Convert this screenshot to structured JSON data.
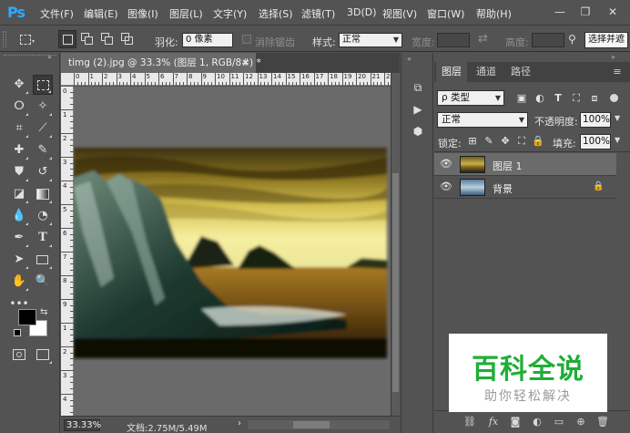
{
  "app": {
    "logo": "Ps"
  },
  "menu": [
    "文件(F)",
    "编辑(E)",
    "图像(I)",
    "图层(L)",
    "文字(Y)",
    "选择(S)",
    "滤镜(T)",
    "3D(D)",
    "视图(V)",
    "窗口(W)",
    "帮助(H)"
  ],
  "window_controls": {
    "minimize": "—",
    "restore": "❐",
    "close": "✕"
  },
  "options": {
    "feather_label": "羽化:",
    "feather_value": "0 像素",
    "antialias_label": "消除锯齿",
    "style_label": "样式:",
    "style_value": "正常",
    "width_label": "宽度:",
    "height_label": "高度:",
    "select_subject": "选择并遮"
  },
  "document": {
    "tab_title": "timg (2).jpg @ 33.3% (图层 1, RGB/8#) *",
    "close": "×",
    "zoom": "33.33%",
    "doc_size": "文档:2.75M/5.49M",
    "status_arrow": "›"
  },
  "rulers": {
    "horizontal": [
      "0",
      "1",
      "2",
      "3",
      "4",
      "5",
      "6",
      "7",
      "8",
      "9",
      "10",
      "11",
      "12",
      "13",
      "14",
      "15",
      "16",
      "17",
      "18",
      "19",
      "20",
      "21",
      "22"
    ],
    "vertical": [
      "0",
      "1",
      "2",
      "3",
      "4",
      "5",
      "6",
      "7",
      "8",
      "9",
      "1",
      "2",
      "3",
      "4"
    ]
  },
  "layers_panel": {
    "tabs": [
      "图层",
      "通道",
      "路径"
    ],
    "menu_icon": "≡",
    "filter_label": "ρ 类型",
    "blend_mode": "正常",
    "opacity_label": "不透明度:",
    "opacity_value": "100%",
    "lock_label": "锁定:",
    "fill_label": "填充:",
    "fill_value": "100%",
    "layers": [
      {
        "name": "图层 1",
        "selected": true
      },
      {
        "name": "背景",
        "locked": true
      }
    ],
    "footer_icons": [
      "link-icon",
      "fx-icon",
      "mask-icon",
      "adjustment-icon",
      "folder-icon",
      "new-layer-icon",
      "trash-icon"
    ],
    "fx_label": "fx"
  },
  "watermark": {
    "title": "百科全说",
    "subtitle": "助你轻松解决"
  },
  "colors": {
    "accent": "#31a8ff",
    "watermark_green": "#1fae38"
  }
}
